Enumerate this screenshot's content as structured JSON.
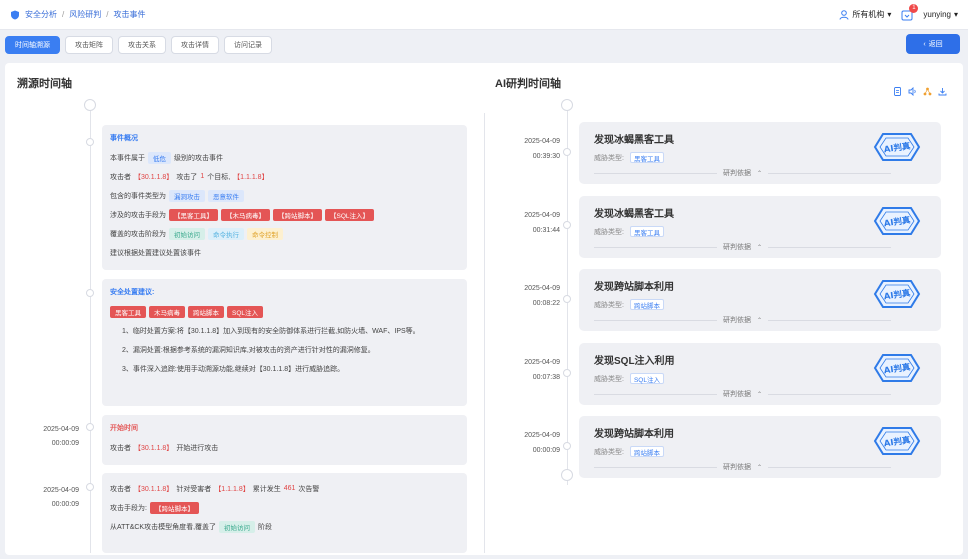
{
  "breadcrumb": [
    "安全分析",
    "风险研判",
    "攻击事件"
  ],
  "topbar": {
    "org": "所有机构",
    "badge": "1",
    "user": "yunying"
  },
  "tabs": [
    "时间轴溯源",
    "攻击矩阵",
    "攻击关系",
    "攻击详情",
    "访问记录"
  ],
  "back_label": "返回",
  "left_title": "溯源时间轴",
  "right_title": "AI研判时间轴",
  "overview": {
    "heading": "事件概况",
    "l1_pre": "本事件属于",
    "l1_tag": "低危",
    "l1_post": "级别的攻击事件",
    "l2_a": "攻击者",
    "l2_ip": "【30.1.1.8】",
    "l2_b": "攻击了",
    "l2_n": "1",
    "l2_c": "个目标,",
    "l2_t": "【1.1.1.8】",
    "l3_pre": "包含的事件类型为",
    "l3_tags": [
      "漏洞攻击",
      "恶意软件"
    ],
    "l4_pre": "涉及的攻击手段为",
    "l4_tags": [
      "【黑客工具】",
      "【木马病毒】",
      "【跨站脚本】",
      "【SQL注入】"
    ],
    "l5_pre": "覆盖的攻击阶段为",
    "l5_tags": [
      "初始访问",
      "命令执行",
      "命令控制"
    ],
    "l6": "建议根据处置建议处置该事件"
  },
  "advice": {
    "heading": "安全处置建议:",
    "tags": [
      "黑客工具",
      "木马病毒",
      "跨站脚本",
      "SQL注入"
    ],
    "p1": "1、临时处置方案:将【30.1.1.8】加入到现有的安全防御体系进行拦截,如防火墙、WAF、IPS等。",
    "p2": "2、漏洞处置:根据参考系统的漏洞知识库,对被攻击的资产进行针对性的漏洞修复。",
    "p3": "3、事件深入追踪:使用手动溯源功能,继续对【30.1.1.8】进行威胁追踪。"
  },
  "start": {
    "date": "2025-04-09",
    "time": "00:00:09",
    "heading": "开始时间",
    "pre": "攻击者",
    "ip": "【30.1.1.8】",
    "post": "开始进行攻击"
  },
  "event2": {
    "date": "2025-04-09",
    "time": "00:00:09",
    "l1_a": "攻击者",
    "l1_ip": "【30.1.1.8】",
    "l1_b": "针对受害者",
    "l1_t": "【1.1.1.8】",
    "l1_c": "累计发生",
    "l1_n": "461",
    "l1_d": "次告警",
    "l2_pre": "攻击手段为:",
    "l2_tag": "【跨站脚本】",
    "l3_pre": "从ATT&CK攻击模型角度看,覆盖了",
    "l3_tag": "初始访问",
    "l3_post": "阶段"
  },
  "ai_items": [
    {
      "date": "2025-04-09",
      "time": "00:39:30",
      "title": "发现冰蝎黑客工具",
      "type_label": "威胁类型:",
      "type": "黑客工具",
      "basis": "研判依据",
      "stamp": "AI判真"
    },
    {
      "date": "2025-04-09",
      "time": "00:31:44",
      "title": "发现冰蝎黑客工具",
      "type_label": "威胁类型:",
      "type": "黑客工具",
      "basis": "研判依据",
      "stamp": "AI判真"
    },
    {
      "date": "2025-04-09",
      "time": "00:08:22",
      "title": "发现跨站脚本利用",
      "type_label": "威胁类型:",
      "type": "跨站脚本",
      "basis": "研判依据",
      "stamp": "AI判真"
    },
    {
      "date": "2025-04-09",
      "time": "00:07:38",
      "title": "发现SQL注入利用",
      "type_label": "威胁类型:",
      "type": "SQL注入",
      "basis": "研判依据",
      "stamp": "AI判真"
    },
    {
      "date": "2025-04-09",
      "time": "00:00:09",
      "title": "发现跨站脚本利用",
      "type_label": "威胁类型:",
      "type": "跨站脚本",
      "basis": "研判依据",
      "stamp": "AI判真"
    }
  ]
}
